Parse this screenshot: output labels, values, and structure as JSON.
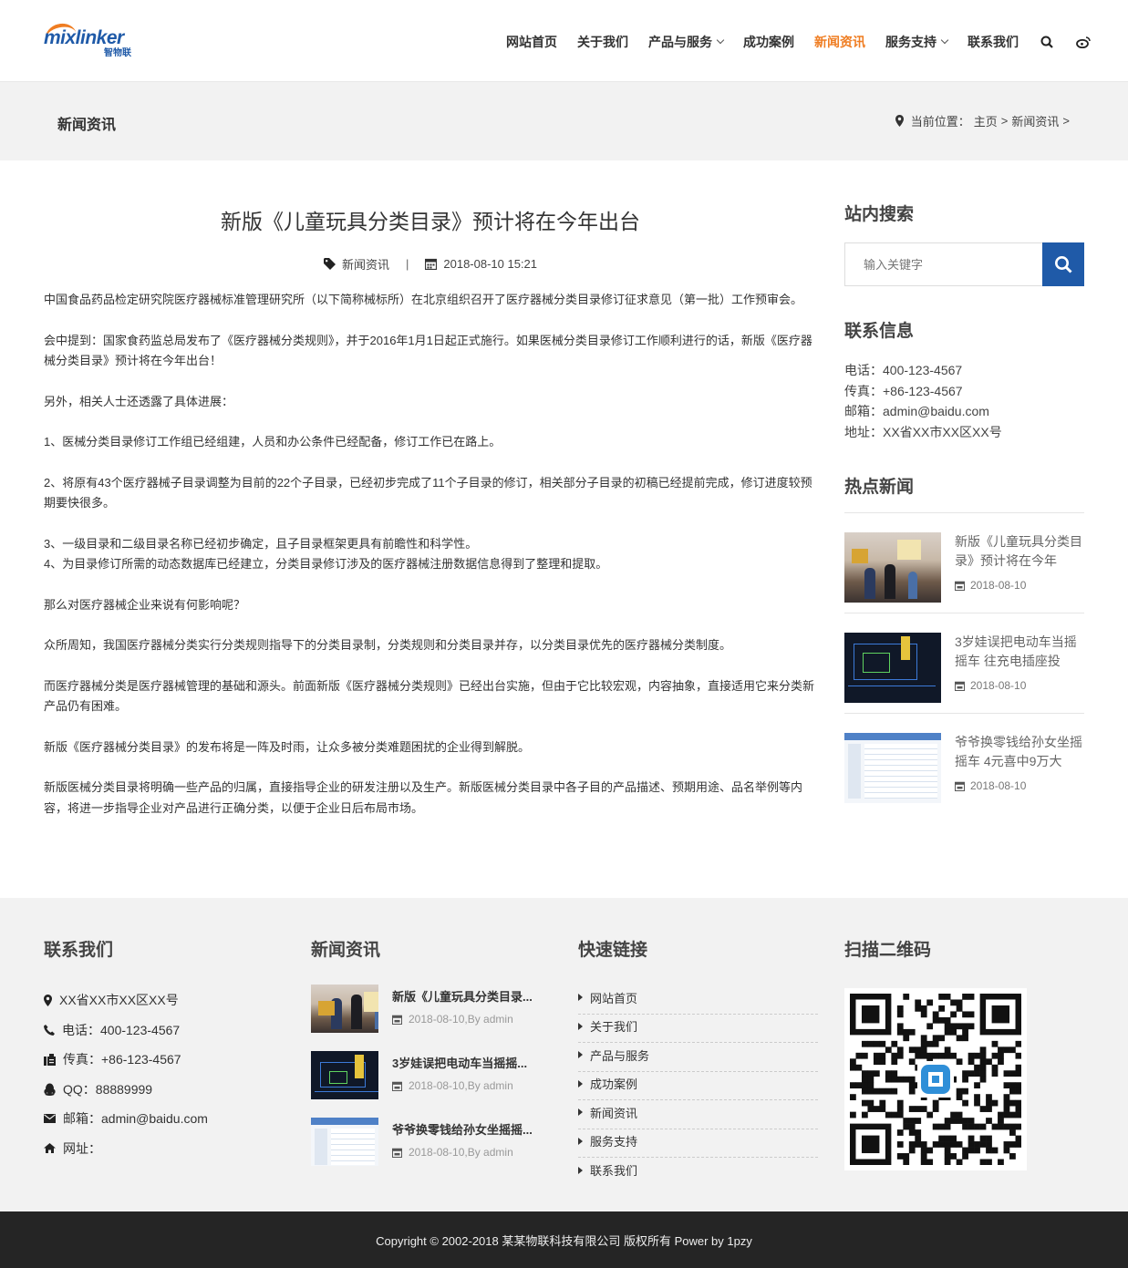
{
  "brand": {
    "logo_text": "mixlinker",
    "logo_sub": "智物联",
    "accent": "#ef7d22",
    "primary": "#1f5aa8"
  },
  "nav": {
    "items": [
      {
        "label": "网站首页",
        "dropdown": false,
        "active": false
      },
      {
        "label": "关于我们",
        "dropdown": false,
        "active": false
      },
      {
        "label": "产品与服务",
        "dropdown": true,
        "active": false
      },
      {
        "label": "成功案例",
        "dropdown": false,
        "active": false
      },
      {
        "label": "新闻资讯",
        "dropdown": false,
        "active": true
      },
      {
        "label": "服务支持",
        "dropdown": true,
        "active": false
      },
      {
        "label": "联系我们",
        "dropdown": false,
        "active": false
      }
    ],
    "icons": [
      "search-icon",
      "weibo-icon"
    ]
  },
  "banner": {
    "title": "新闻资讯",
    "breadcrumb_prefix": "当前位置：",
    "breadcrumb_home": "主页",
    "breadcrumb_sep1": ">",
    "breadcrumb_current": "新闻资讯",
    "breadcrumb_sep2": ">"
  },
  "article": {
    "title": "新版《儿童玩具分类目录》预计将在今年出台",
    "category": "新闻资讯",
    "meta_sep": "|",
    "datetime": "2018-08-10 15:21",
    "paragraphs": [
      "中国食品药品检定研究院医疗器械标准管理研究所（以下简称械标所）在北京组织召开了医疗器械分类目录修订征求意见（第一批）工作预审会。",
      "会中提到：国家食药监总局发布了《医疗器械分类规则》，并于2016年1月1日起正式施行。如果医械分类目录修订工作顺利进行的话，新版《医疗器械分类目录》预计将在今年出台！",
      "另外，相关人士还透露了具体进展：",
      "1、医械分类目录修订工作组已经组建，人员和办公条件已经配备，修订工作已在路上。",
      "2、将原有43个医疗器械子目录调整为目前的22个子目录，已经初步完成了11个子目录的修订，相关部分子目录的初稿已经提前完成，修订进度较预期要快很多。",
      "3、一级目录和二级目录名称已经初步确定，且子目录框架更具有前瞻性和科学性。",
      "4、为目录修订所需的动态数据库已经建立，分类目录修订涉及的医疗器械注册数据信息得到了整理和提取。",
      "那么对医疗器械企业来说有何影响呢？",
      "众所周知，我国医疗器械分类实行分类规则指导下的分类目录制，分类规则和分类目录并存，以分类目录优先的医疗器械分类制度。",
      "而医疗器械分类是医疗器械管理的基础和源头。前面新版《医疗器械分类规则》已经出台实施，但由于它比较宏观，内容抽象，直接适用它来分类新产品仍有困难。",
      "新版《医疗器械分类目录》的发布将是一阵及时雨，让众多被分类难题困扰的企业得到解脱。",
      "新版医械分类目录将明确一些产品的归属，直接指导企业的研发注册以及生产。新版医械分类目录中各子目的产品描述、预期用途、品名举例等内容，将进一步指导企业对产品进行正确分类，以便于企业日后布局市场。"
    ]
  },
  "sidebar": {
    "search_title": "站内搜索",
    "search_placeholder": "输入关键字",
    "contact_title": "联系信息",
    "contact_lines": [
      "电话：400-123-4567",
      "传真：+86-123-4567",
      "邮箱：admin@baidu.com",
      "地址：XX省XX市XX区XX号"
    ],
    "hot_title": "热点新闻",
    "hot_news": [
      {
        "title": "新版《儿童玩具分类目录》预计将在今年",
        "date": "2018-08-10"
      },
      {
        "title": "3岁娃误把电动车当摇摇车 往充电插座投",
        "date": "2018-08-10"
      },
      {
        "title": "爷爷换零钱给孙女坐摇摇车 4元喜中9万大",
        "date": "2018-08-10"
      }
    ]
  },
  "footer": {
    "contact_title": "联系我们",
    "contact": {
      "address": "XX省XX市XX区XX号",
      "phone": "电话：400-123-4567",
      "fax": "传真：+86-123-4567",
      "qq": "QQ：88889999",
      "email": "邮箱：admin@baidu.com",
      "website": "网址："
    },
    "news_title": "新闻资讯",
    "news": [
      {
        "title": "新版《儿童玩具分类目录...",
        "meta": "2018-08-10,By admin"
      },
      {
        "title": "3岁娃误把电动车当摇摇...",
        "meta": "2018-08-10,By admin"
      },
      {
        "title": "爷爷换零钱给孙女坐摇摇...",
        "meta": "2018-08-10,By admin"
      }
    ],
    "links_title": "快速链接",
    "links": [
      "网站首页",
      "关于我们",
      "产品与服务",
      "成功案例",
      "新闻资讯",
      "服务支持",
      "联系我们"
    ],
    "qr_title": "扫描二维码",
    "copyright": "Copyright © 2002-2018 某某物联科技有限公司 版权所有 Power by 1pzy"
  }
}
